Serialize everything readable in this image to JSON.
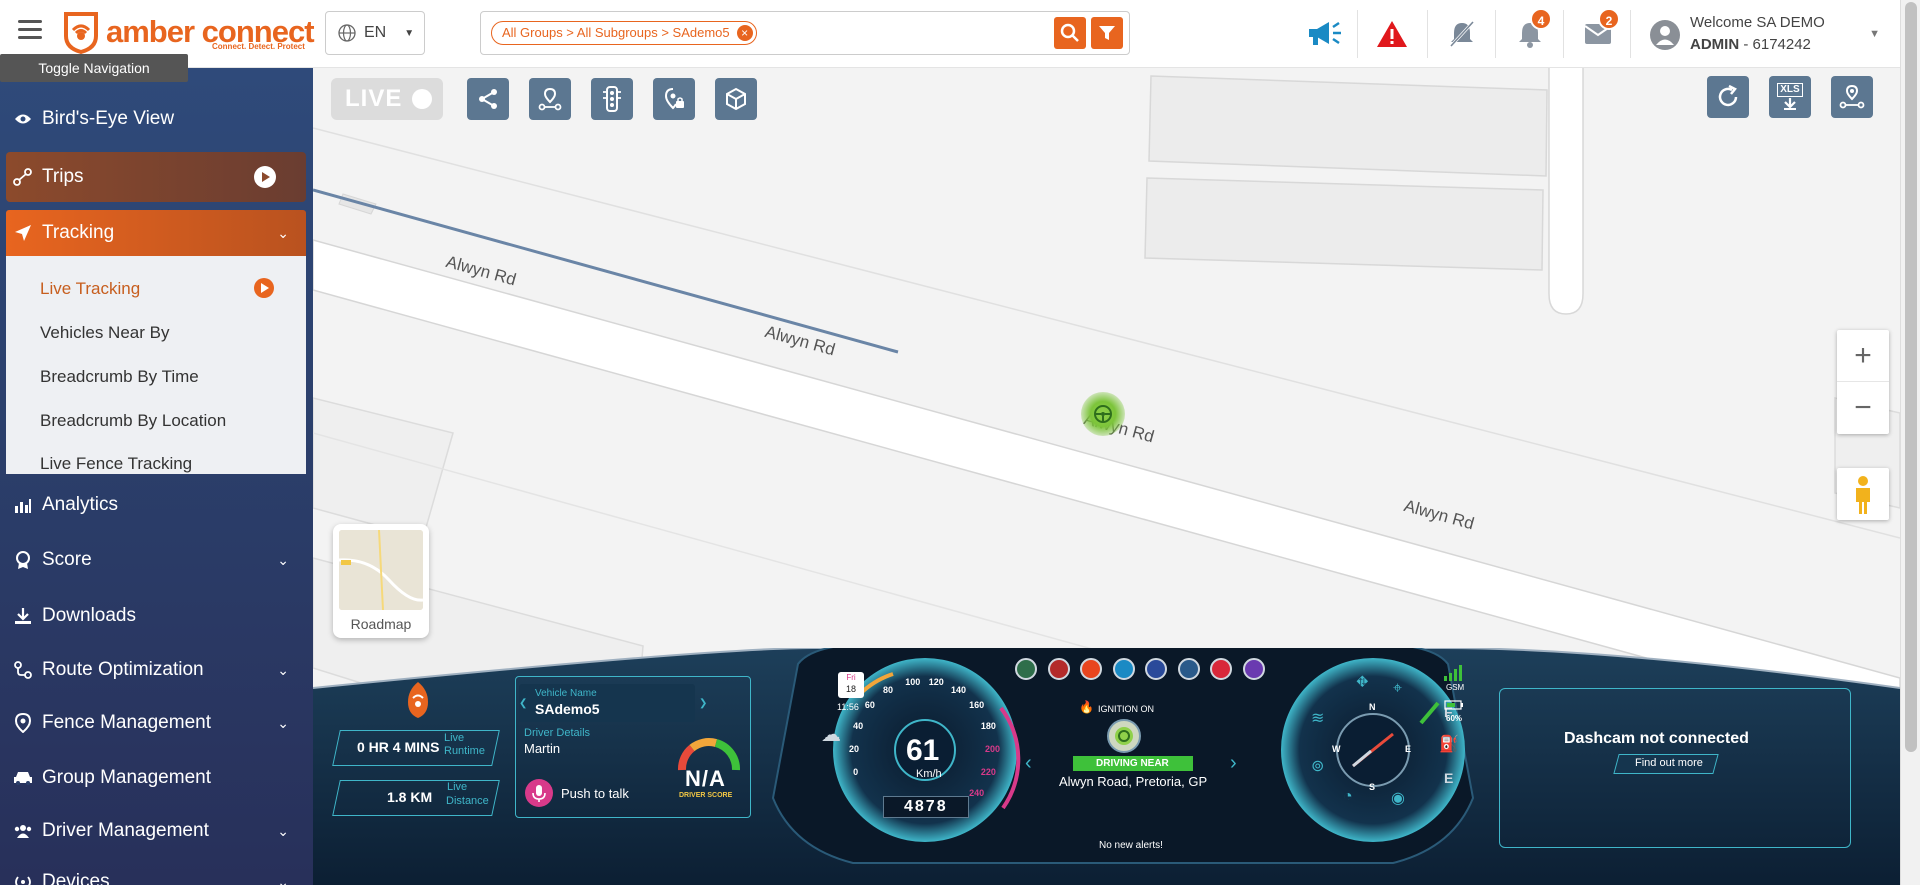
{
  "header": {
    "toggle_tooltip": "Toggle Navigation",
    "logo_text": "amber connect",
    "logo_tagline": "Connect. Detect. Protect",
    "language": "EN",
    "search_chip": "All Groups > All Subgroups > SAdemo5",
    "notifications_count": "4",
    "messages_count": "2",
    "welcome": "Welcome SA DEMO",
    "role": "ADMIN",
    "account_number": "- 6174242"
  },
  "sidebar": {
    "items": [
      {
        "label": "Bird's-Eye View"
      },
      {
        "label": "Trips"
      },
      {
        "label": "Tracking"
      },
      {
        "label": "Analytics"
      },
      {
        "label": "Score"
      },
      {
        "label": "Downloads"
      },
      {
        "label": "Route Optimization"
      },
      {
        "label": "Fence Management"
      },
      {
        "label": "Group Management"
      },
      {
        "label": "Driver Management"
      },
      {
        "label": "Devices"
      }
    ],
    "tracking_sub": [
      {
        "label": "Live Tracking"
      },
      {
        "label": "Vehicles Near By"
      },
      {
        "label": "Breadcrumb By Time"
      },
      {
        "label": "Breadcrumb By Location"
      },
      {
        "label": "Live Fence Tracking"
      }
    ]
  },
  "map": {
    "live_label": "LIVE",
    "road_name": "Alwyn Rd",
    "roadmap_label": "Roadmap",
    "zoom_in": "+",
    "zoom_out": "−",
    "export_label": "XLS"
  },
  "dashboard": {
    "runtime": "0 HR 4 MINS",
    "runtime_label_1": "Live",
    "runtime_label_2": "Runtime",
    "distance": "1.8 KM",
    "distance_label_1": "Live",
    "distance_label_2": "Distance",
    "vehicle_name_label": "Vehicle Name",
    "vehicle_name": "SAdemo5",
    "driver_details_label": "Driver Details",
    "driver_name": "Martin",
    "push_to_talk": "Push to talk",
    "driver_score": "N/A",
    "driver_score_label": "DRIVER SCORE",
    "date_day": "Fri",
    "date_num": "18",
    "time": "11:56",
    "speed": "61",
    "speed_unit": "Km/h",
    "odometer": "4878",
    "ignition": "IGNITION ON",
    "status": "DRIVING NEAR",
    "location": "Alwyn Road, Pretoria, GP",
    "alerts": "No new alerts!",
    "gsm_label": "GSM",
    "battery": "60%",
    "fuel_full": "F",
    "fuel_empty": "E",
    "compass_n": "N",
    "compass_s": "S",
    "compass_e": "E",
    "compass_w": "W",
    "dashcam_title": "Dashcam not connected",
    "dashcam_link": "Find out more",
    "speedo_ticks": [
      "0",
      "20",
      "40",
      "60",
      "80",
      "100",
      "120",
      "140",
      "160",
      "180",
      "200",
      "220",
      "240"
    ]
  },
  "colors": {
    "brand_orange": "#e8651f",
    "sidebar_blue": "#2f4a7a",
    "dash_cyan": "#3fb6c9",
    "driving_green": "#3ec13a"
  }
}
